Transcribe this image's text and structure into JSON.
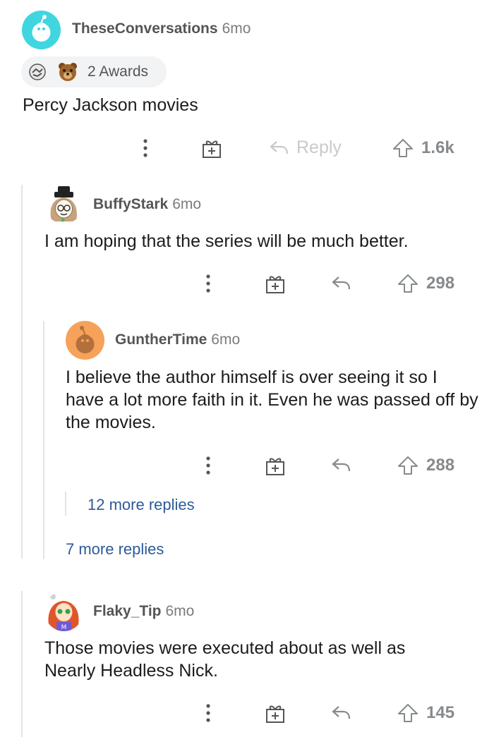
{
  "comments": [
    {
      "username": "TheseConversations",
      "time": "6mo",
      "awards": "2 Awards",
      "body": "Percy Jackson movies",
      "reply_label": "Reply",
      "votes": "1.6k",
      "avatar_color": "#3fd6e0"
    },
    {
      "username": "BuffyStark",
      "time": "6mo",
      "body": "I am hoping that the series will be much better.",
      "votes": "298"
    },
    {
      "username": "GuntherTime",
      "time": "6mo",
      "body": "I believe the author himself is over seeing it so I have a lot more faith in it. Even he was passed off by the movies.",
      "votes": "288",
      "avatar_color": "#f6a25a"
    },
    {
      "username": "Flaky_Tip",
      "time": "6mo",
      "body": "Those movies were executed about as well as Nearly Headless Nick.",
      "votes": "145"
    }
  ],
  "more_replies": {
    "nested": "12 more replies",
    "outer": "7 more replies"
  },
  "colors": {
    "link": "#2d5a9a",
    "muted": "#878a8c",
    "thread_line": "#e2e4e6"
  }
}
